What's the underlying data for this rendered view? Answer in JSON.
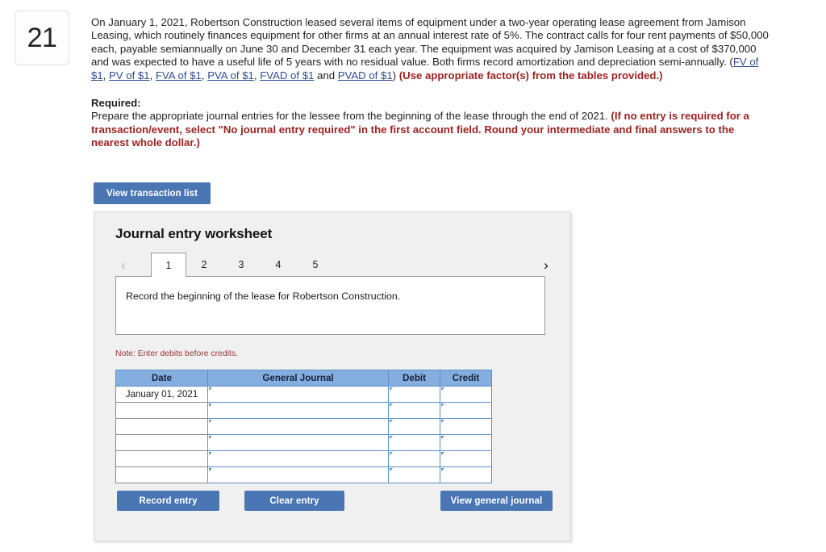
{
  "question": {
    "number": "21",
    "stem_part1": "On January 1, 2021, Robertson Construction leased several items of equipment under a two-year operating lease agreement from Jamison Leasing, which routinely finances equipment for other firms at an annual interest rate of 5%.  The contract calls for four rent payments of $50,000 each, payable semiannually on June 30 and December 31 each year.  The equipment was acquired by Jamison Leasing at a cost of $370,000 and was expected to have a useful life of 5 years with no residual value.  Both firms record amortization and depreciation semi-annually. (",
    "links": [
      "FV of $1",
      "PV of $1",
      "FVA of $1",
      "PVA of $1",
      "FVAD of $1",
      "PVAD of $1"
    ],
    "link_sep": ", ",
    "link_and": " and ",
    "stem_paren_close": ") ",
    "stem_red": "(Use appropriate factor(s) from the tables provided.)"
  },
  "required": {
    "label": "Required:",
    "text": "Prepare the appropriate journal entries for the lessee from the beginning of the lease through the end of 2021. ",
    "red": "(If no entry is required for a transaction/event, select \"No journal entry required\" in the first account field. Round your intermediate and final answers to the nearest whole dollar.)"
  },
  "toolbar": {
    "view_transaction_list": "View transaction list"
  },
  "worksheet": {
    "title": "Journal entry worksheet",
    "tabs": [
      "1",
      "2",
      "3",
      "4",
      "5"
    ],
    "active_tab": "1",
    "prev_arrow": "‹",
    "next_arrow": "›",
    "instruction": "Record the beginning of the lease for Robertson Construction.",
    "note": "Note: Enter debits before credits."
  },
  "journal": {
    "headers": [
      "Date",
      "General Journal",
      "Debit",
      "Credit"
    ],
    "rows": [
      {
        "date": "January 01, 2021",
        "general_journal": "",
        "debit": "",
        "credit": ""
      },
      {
        "date": "",
        "general_journal": "",
        "debit": "",
        "credit": ""
      },
      {
        "date": "",
        "general_journal": "",
        "debit": "",
        "credit": ""
      },
      {
        "date": "",
        "general_journal": "",
        "debit": "",
        "credit": ""
      },
      {
        "date": "",
        "general_journal": "",
        "debit": "",
        "credit": ""
      },
      {
        "date": "",
        "general_journal": "",
        "debit": "",
        "credit": ""
      }
    ]
  },
  "actions": {
    "record_entry": "Record entry",
    "clear_entry": "Clear entry",
    "view_general_journal": "View general journal"
  },
  "colors": {
    "button_blue": "#4a77b4",
    "table_header_blue": "#85aee0",
    "cell_border_blue": "#5f8fc4",
    "red_emphasis": "#9c2222",
    "note_red": "#9c3434",
    "link_blue": "#2f4d91",
    "panel_bg": "#f0f0f0"
  }
}
